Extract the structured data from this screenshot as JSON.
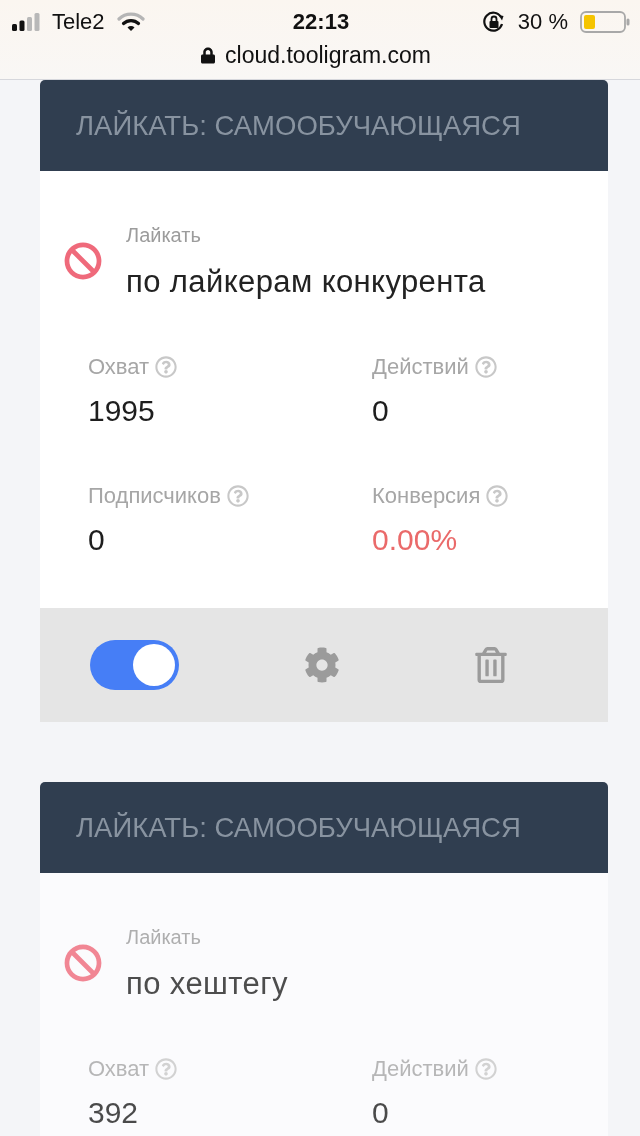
{
  "status_bar": {
    "carrier": "Tele2",
    "time": "22:13",
    "battery": "30 %",
    "url": "cloud.tooligram.com"
  },
  "cards": [
    {
      "title": "ЛАЙКАТЬ: САМООБУЧАЮЩАЯСЯ",
      "dimmed": false,
      "action": "Лайкать",
      "target": "по лайкерам конкурента",
      "stats": [
        {
          "label": "Охват",
          "value": "1995",
          "alert": false
        },
        {
          "label": "Действий",
          "value": "0",
          "alert": false
        },
        {
          "label": "Подписчиков",
          "value": "0",
          "alert": false
        },
        {
          "label": "Конверсия",
          "value": "0.00%",
          "alert": true
        }
      ],
      "switch": {
        "on": true
      }
    },
    {
      "title": "ЛАЙКАТЬ: САМООБУЧАЮЩАЯСЯ",
      "dimmed": true,
      "action": "Лайкать",
      "target": "по хештегу",
      "stats": [
        {
          "label": "Охват",
          "value": "392",
          "alert": false
        },
        {
          "label": "Действий",
          "value": "0",
          "alert": false
        }
      ]
    }
  ]
}
